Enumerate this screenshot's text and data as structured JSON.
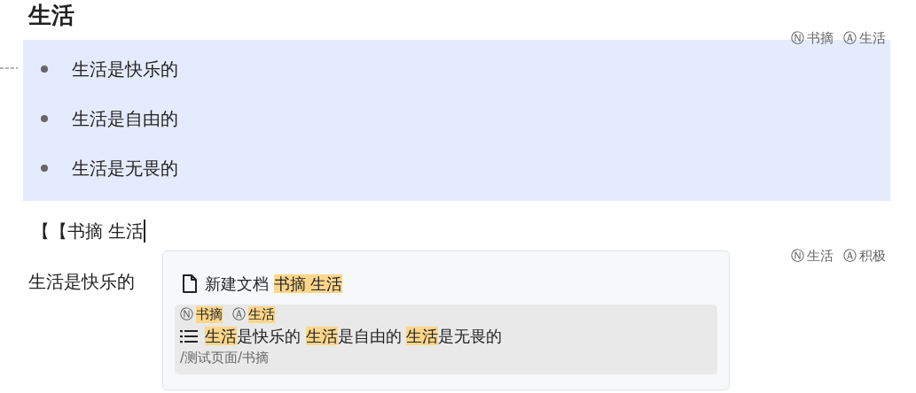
{
  "title": "生活",
  "block_tags": [
    {
      "mark": "Ⓝ",
      "label": "书摘"
    },
    {
      "mark": "Ⓐ",
      "label": "生活"
    }
  ],
  "bullets": [
    "生活是快乐的",
    "生活是自由的",
    "生活是无畏的"
  ],
  "input_line": "【【书摘 生活",
  "paragraph_tags": [
    {
      "mark": "Ⓝ",
      "label": "生活"
    },
    {
      "mark": "Ⓐ",
      "label": "积极"
    }
  ],
  "paragraph": "生活是快乐的",
  "popup": {
    "items": [
      {
        "kind": "new",
        "selected": false,
        "segments": [
          {
            "text": "新建文档 ",
            "highlighted": false
          },
          {
            "text": "书摘 生活",
            "highlighted": true
          }
        ]
      },
      {
        "kind": "list",
        "selected": true,
        "tags": [
          {
            "mark": "Ⓝ",
            "label": "书摘"
          },
          {
            "mark": "Ⓐ",
            "label": "生活"
          }
        ],
        "segments": [
          {
            "text": "生活",
            "highlighted": true
          },
          {
            "text": "是快乐的 ",
            "highlighted": false
          },
          {
            "text": "生活",
            "highlighted": true
          },
          {
            "text": "是自由的 ",
            "highlighted": false
          },
          {
            "text": "生活",
            "highlighted": true
          },
          {
            "text": "是无畏的",
            "highlighted": false
          }
        ],
        "path": "/测试页面/书摘"
      }
    ]
  }
}
